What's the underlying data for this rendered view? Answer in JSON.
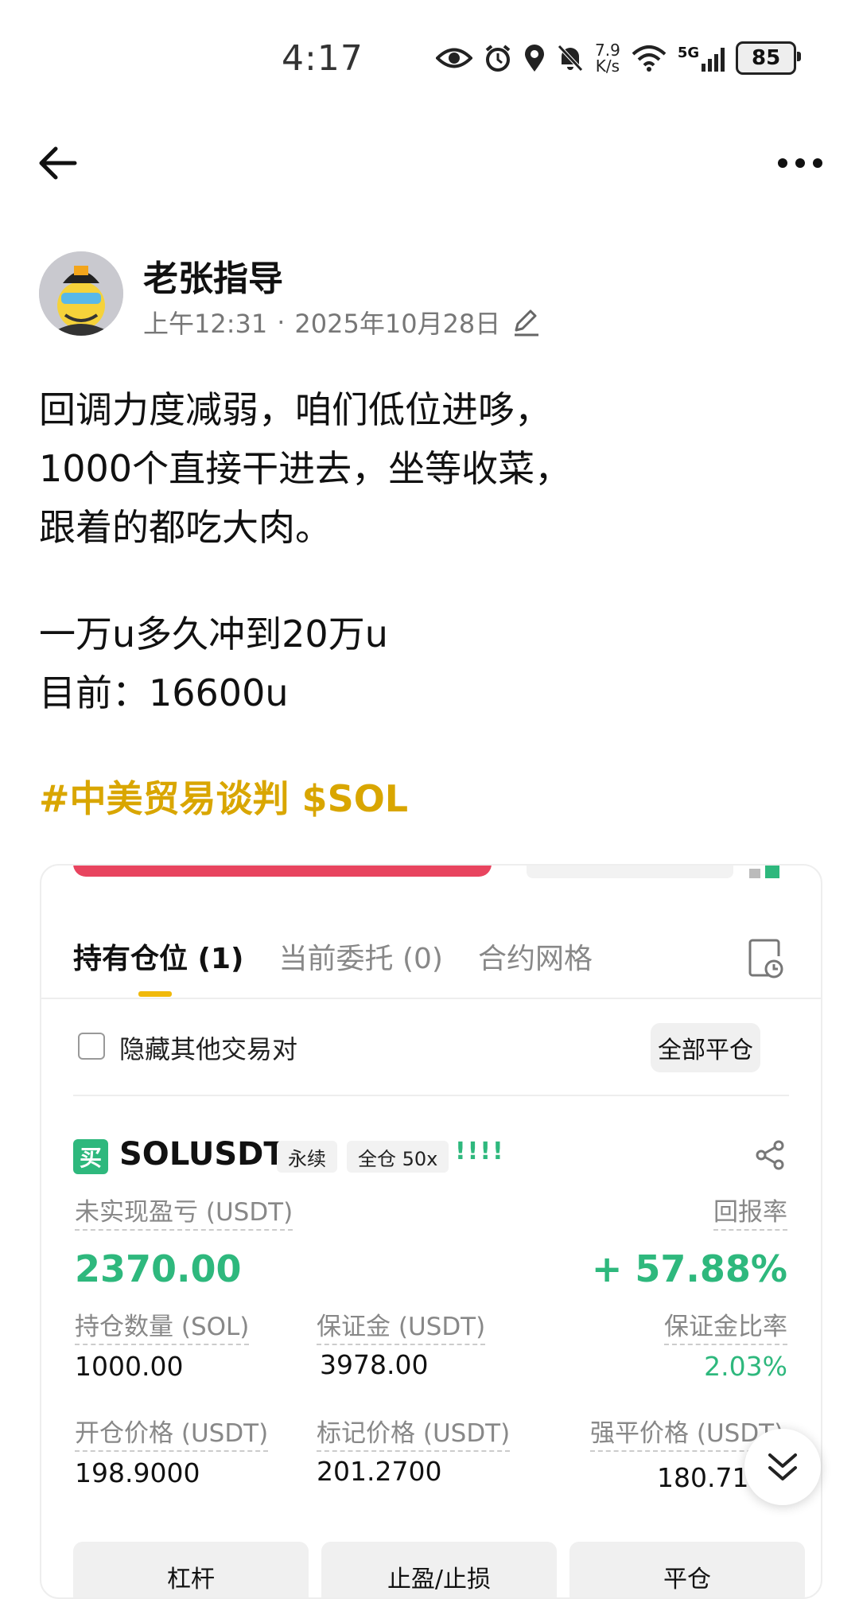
{
  "status_bar": {
    "time": "4:17",
    "net_speed_value": "7.9",
    "net_speed_unit": "K/s",
    "network": "5G",
    "battery": "85",
    "icons": [
      "eye-icon",
      "alarm-icon",
      "location-icon",
      "mute-icon",
      "wifi-icon",
      "signal-icon",
      "battery-icon"
    ]
  },
  "top_bar": {
    "back_icon": "arrow-left-icon",
    "more_icon": "more-horizontal-icon"
  },
  "post": {
    "author": "老张指导",
    "time": "上午12:31",
    "separator": "·",
    "date": "2025年10月28日",
    "lines": [
      "回调力度减弱，咱们低位进哆，",
      "1000个直接干进去，坐等收菜，",
      "跟着的都吃大肉。",
      "一万u多久冲到20万u",
      "目前：16600u"
    ],
    "tags": "#中美贸易谈判 $SOL",
    "tag_color": "#d9a600"
  },
  "card": {
    "tabs": [
      "持有仓位 (1)",
      "当前委托 (0)",
      "合约网格"
    ],
    "hide_pairs_label": "隐藏其他交易对",
    "close_all_label": "全部平仓",
    "position": {
      "side_badge": "买",
      "symbol": "SOLUSDT",
      "tag_type": "永续",
      "tag_margin": "全仓 50x",
      "warning": "!!!!",
      "pnl_label": "未实现盈亏 (USDT)",
      "pnl_value": "2370.00",
      "roe_label": "回报率",
      "roe_value": "+ 57.88%",
      "size_label": "持仓数量 (SOL)",
      "size_value": "1000.00",
      "margin_label": "保证金 (USDT)",
      "margin_value": "3978.00",
      "margin_ratio_label": "保证金比率",
      "margin_ratio_value": "2.03%",
      "entry_label": "开仓价格 (USDT)",
      "entry_value": "198.9000",
      "mark_label": "标记价格 (USDT)",
      "mark_value": "201.2700",
      "liq_label": "强平价格 (USDT)",
      "liq_value": "180.7167"
    },
    "buttons": [
      "杠杆",
      "止盈/止损",
      "平仓"
    ],
    "accent_green": "#2eb87d",
    "accent_yellow": "#f0b90b",
    "accent_red": "#e8445f"
  }
}
